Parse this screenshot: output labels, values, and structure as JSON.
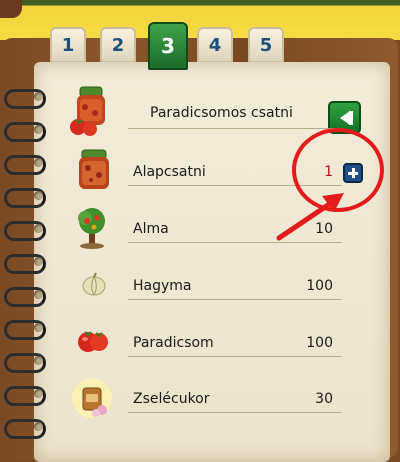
{
  "tabs": [
    {
      "label": "1",
      "active": false
    },
    {
      "label": "2",
      "active": false
    },
    {
      "label": "3",
      "active": true
    },
    {
      "label": "4",
      "active": false
    },
    {
      "label": "5",
      "active": false
    }
  ],
  "recipe": {
    "title": "Paradicsomos csatni",
    "icon": "tomato-chutney-jar-icon"
  },
  "ingredients": [
    {
      "label": "Alapcsatni",
      "qty": "1",
      "icon": "chutney-jar-icon",
      "qty_color": "#b3121b"
    },
    {
      "label": "Alma",
      "qty": "10",
      "icon": "apple-tree-icon"
    },
    {
      "label": "Hagyma",
      "qty": "100",
      "icon": "onion-icon"
    },
    {
      "label": "Paradicsom",
      "qty": "100",
      "icon": "tomato-icon"
    },
    {
      "label": "Zselécukor",
      "qty": "30",
      "icon": "gelling-sugar-icon"
    }
  ],
  "colors": {
    "annotation": "#e41b1b",
    "active_tab": "#2a8a3a",
    "plus_button": "#1f4f86"
  }
}
